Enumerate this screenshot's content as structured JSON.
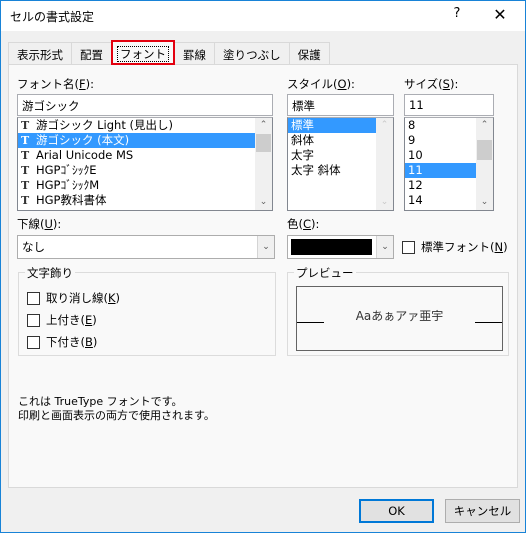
{
  "window": {
    "title": "セルの書式設定",
    "help_label": "?",
    "close_label": "✕"
  },
  "tabs": [
    {
      "label": "表示形式",
      "active": false
    },
    {
      "label": "配置",
      "active": false
    },
    {
      "label": "フォント",
      "active": true
    },
    {
      "label": "罫線",
      "active": false
    },
    {
      "label": "塗りつぶし",
      "active": false
    },
    {
      "label": "保護",
      "active": false
    }
  ],
  "font_name": {
    "label_pre": "フォント名(",
    "accel": "F",
    "label_post": "):",
    "value": "游ゴシック",
    "items": [
      "游ゴシック Light (見出し)",
      "游ゴシック (本文)",
      "Arial Unicode MS",
      "HGPｺﾞｼｯｸE",
      "HGPｺﾞｼｯｸM",
      "HGP教科書体"
    ],
    "selected_index": 1,
    "item_icon": "truetype-icon",
    "item_icon_glyph": "T"
  },
  "style": {
    "label_pre": "スタイル(",
    "accel": "O",
    "label_post": "):",
    "value": "標準",
    "items": [
      "標準",
      "斜体",
      "太字",
      "太字 斜体"
    ],
    "selected_index": 0
  },
  "size": {
    "label_pre": "サイズ(",
    "accel": "S",
    "label_post": "):",
    "value": "11",
    "items": [
      "8",
      "9",
      "10",
      "11",
      "12",
      "14"
    ],
    "selected_index": 3
  },
  "underline": {
    "label_pre": "下線(",
    "accel": "U",
    "label_post": "):",
    "value": "なし"
  },
  "color": {
    "label_pre": "色(",
    "accel": "C",
    "label_post": "):",
    "value_hex": "#000000"
  },
  "normal_font": {
    "label_pre": "標準フォント(",
    "accel": "N",
    "label_post": ")",
    "checked": false
  },
  "effects": {
    "title": "文字飾り",
    "items": [
      {
        "label_pre": "取り消し線(",
        "accel": "K",
        "label_post": ")",
        "checked": false
      },
      {
        "label_pre": "上付き(",
        "accel": "E",
        "label_post": ")",
        "checked": false
      },
      {
        "label_pre": "下付き(",
        "accel": "B",
        "label_post": ")",
        "checked": false
      }
    ]
  },
  "preview": {
    "title": "プレビュー",
    "sample": "Aaあぁアァ亜宇"
  },
  "info": {
    "line1": "これは TrueType フォントです。",
    "line2": "印刷と画面表示の両方で使用されます。"
  },
  "buttons": {
    "ok": "OK",
    "cancel": "キャンセル"
  },
  "scroll_glyphs": {
    "up": "⌃",
    "down": "⌄",
    "dropdown": "⌄"
  },
  "colors": {
    "accent": "#1883d7",
    "selection": "#3399ff",
    "active_tab_highlight": "#e3000f"
  }
}
